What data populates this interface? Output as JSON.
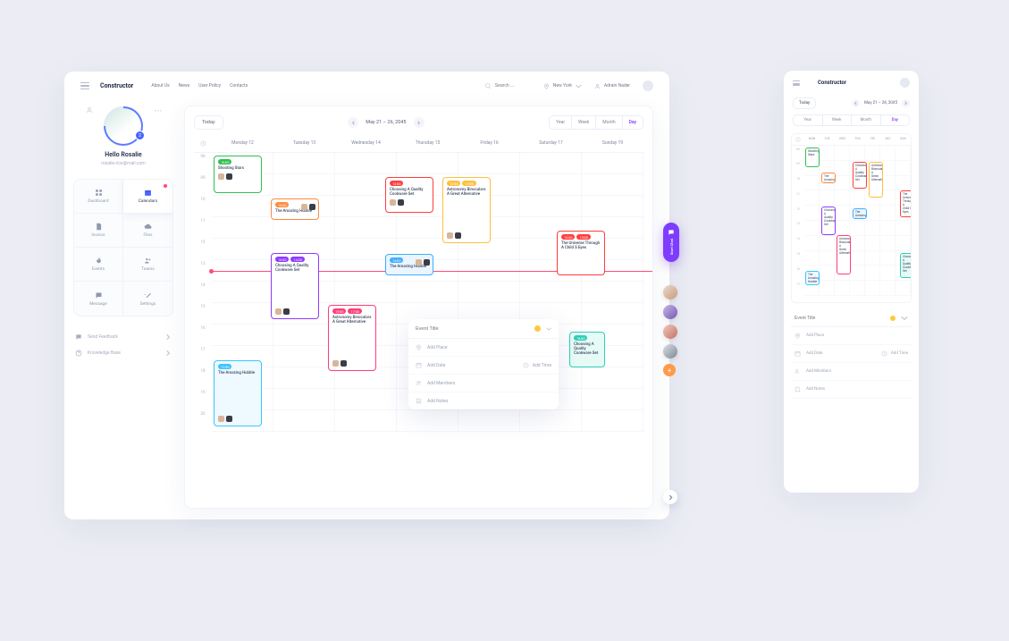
{
  "brand": "Constructor",
  "nav": {
    "about": "About Us",
    "news": "News",
    "policy": "User Policy",
    "contacts": "Contacts"
  },
  "search": {
    "placeholder": "Search ..."
  },
  "location": "New York",
  "user_name": "Adrain Nader",
  "profile": {
    "hello": "Hello Rosalie",
    "email": "rosalie.rice@mail.com",
    "badge": "2"
  },
  "sidenav": {
    "dashboard": "Dashboard",
    "calendars": "Calendars",
    "invoice": "Invoice",
    "files": "Files",
    "events": "Events",
    "teams": "Teams",
    "message": "Message",
    "settings": "Settings"
  },
  "footer": {
    "feedback": "Send Feedback",
    "kb": "Knowledge Base"
  },
  "calendar": {
    "today": "Today",
    "range": "May 21 – 26, 2045",
    "view": {
      "year": "Year",
      "week": "Week",
      "month": "Month",
      "day": "Day"
    },
    "days": [
      "Monday 12",
      "Tuesday 13",
      "Wednesday 14",
      "Thursday 15",
      "Friday 16",
      "Saturday 17",
      "Sunday 19"
    ],
    "hours": [
      "08",
      "09",
      "10",
      "11",
      "12",
      "13",
      "14",
      "15",
      "16",
      "17",
      "18",
      "19",
      "20"
    ]
  },
  "events": {
    "shooting": "Shooting Stars",
    "hubble": "The Amazing Hubble",
    "cook": "Choosing A Quality Cookware Set",
    "astro": "Astronomy Binoculars A Great Alternative",
    "universe": "The Universe Through A Child S Eyes"
  },
  "tags": {
    "green": "10:00",
    "orange_a": "13:00",
    "orange_b": "12:00",
    "purple_a": "13:00",
    "purple_b": "14:00",
    "cyan_a": "14:00",
    "cyan_b": "15:00",
    "pink_a": "15:00",
    "pink_b": "17:00",
    "blue_a": "15:00",
    "blue_b": "17:00",
    "teal": "17:00",
    "yellow_a": "12:00",
    "yellow_b": "14:00",
    "red_a": "13:00",
    "red_b": "15:00",
    "seagreen": "18:00"
  },
  "chat": "Start Chat",
  "popover": {
    "title_placeholder": "Event Title",
    "place": "Add Place",
    "date": "Add Date",
    "time": "Add Time",
    "members": "Add Members",
    "notes": "Add Notes"
  },
  "mobile": {
    "dayhead": [
      "MON",
      "TUE",
      "WED",
      "THU",
      "FRI",
      "SAT",
      "SUN"
    ],
    "hours": [
      "08",
      "09",
      "10",
      "11",
      "12",
      "13",
      "14",
      "15",
      "16",
      "17"
    ]
  }
}
